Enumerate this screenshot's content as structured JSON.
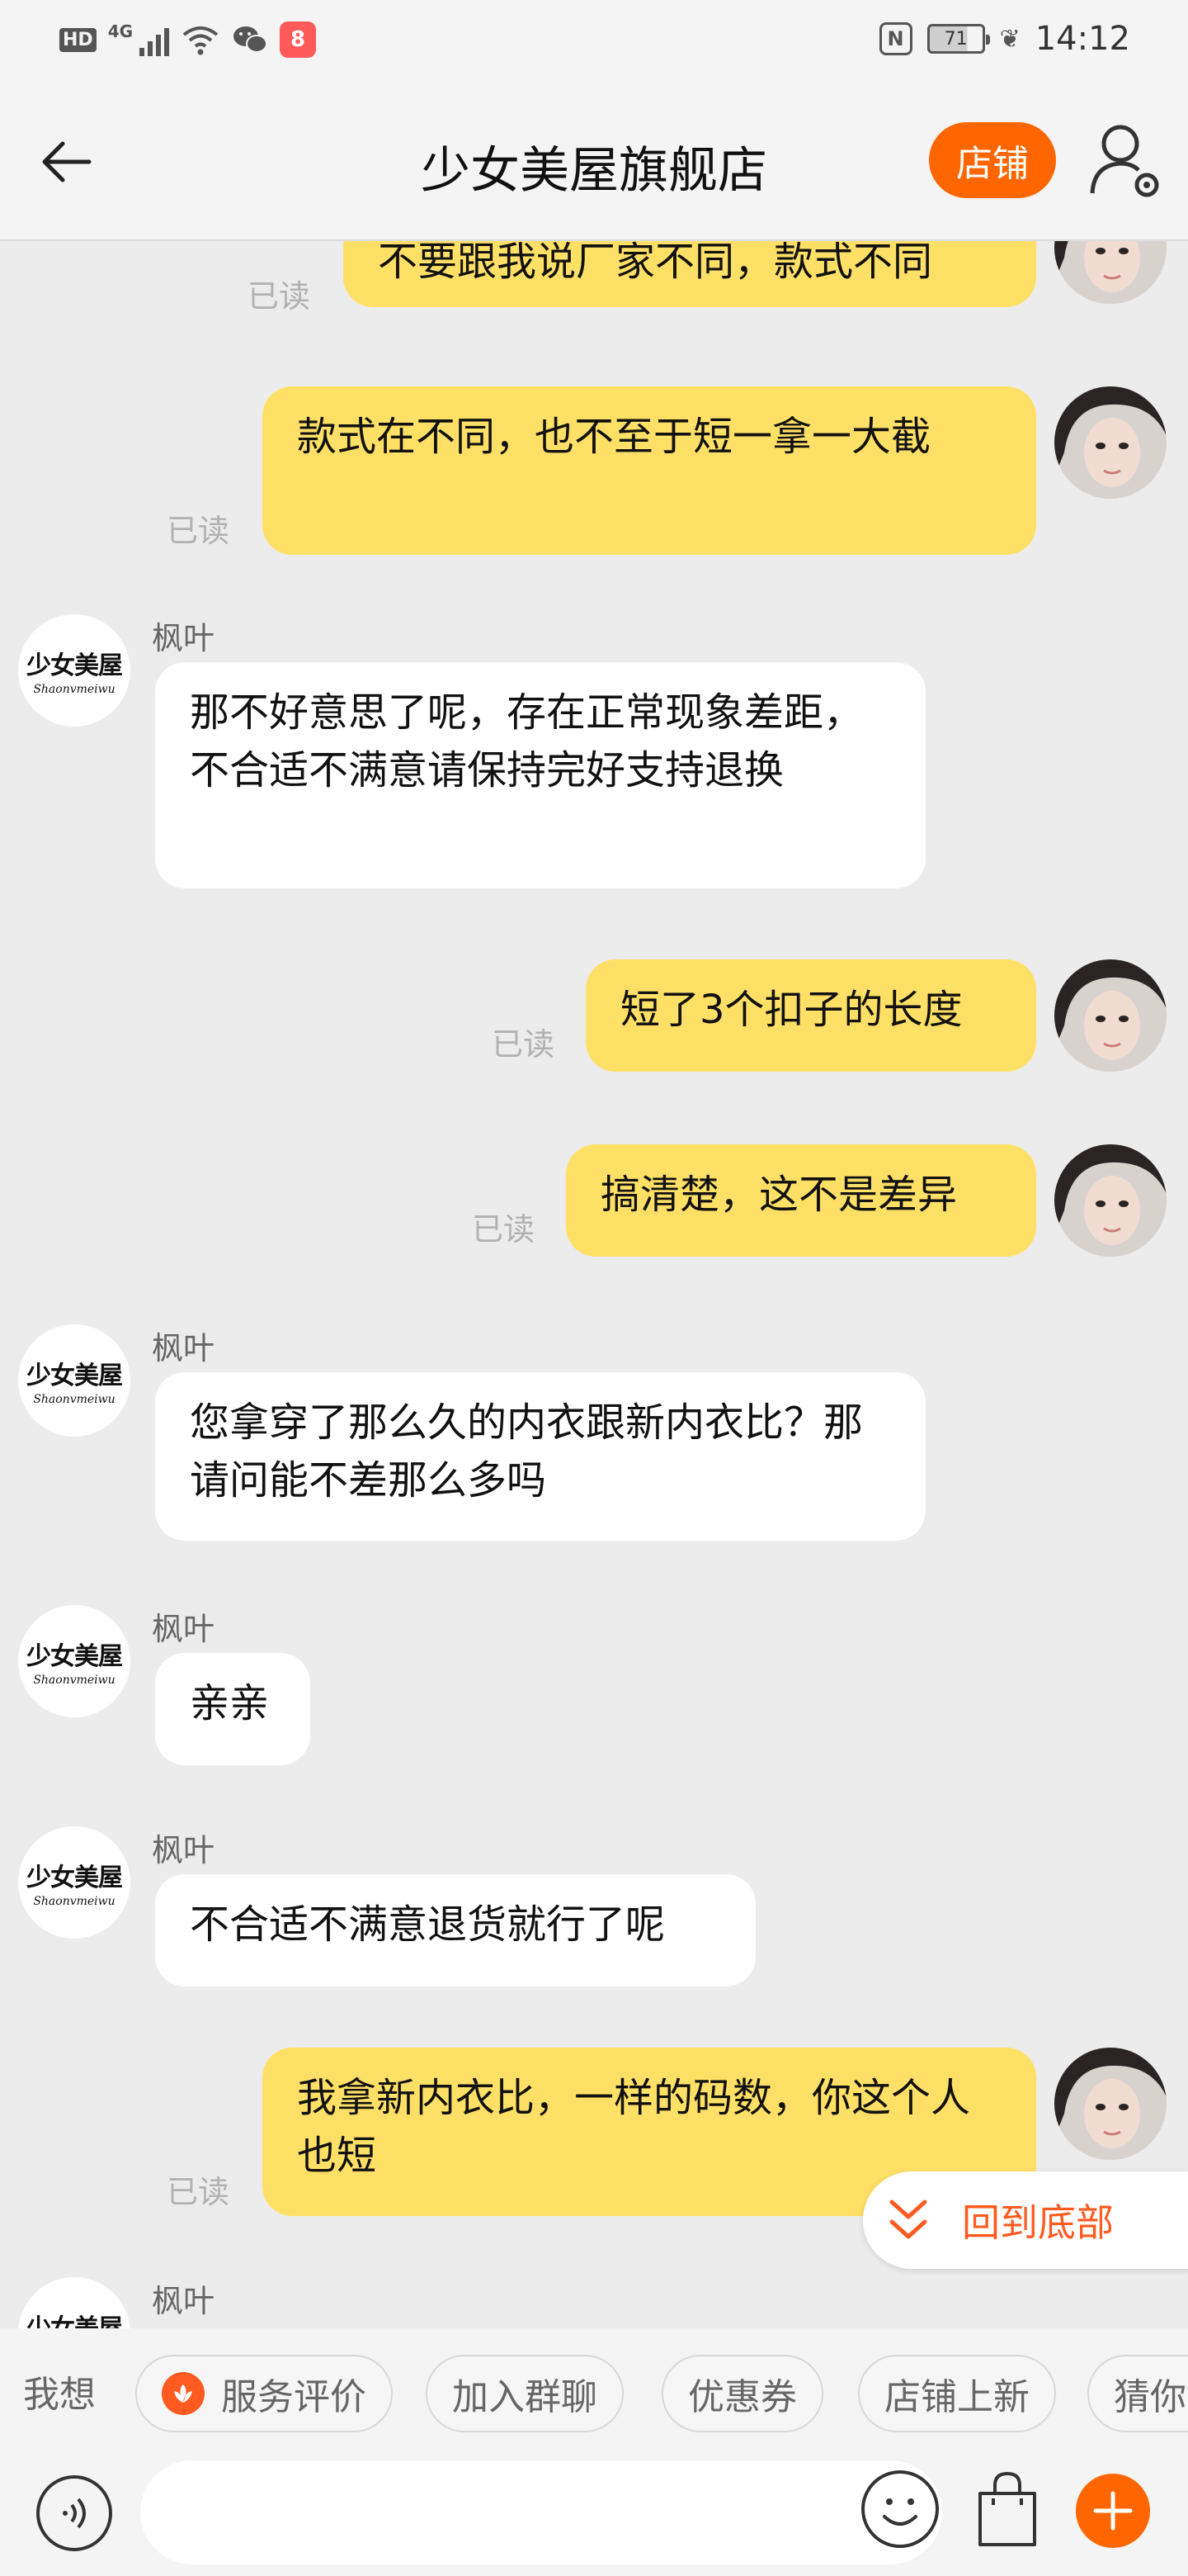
{
  "status_bar": {
    "hd": "HD",
    "network": "4G",
    "app_badge_text": "8",
    "nfc": "N",
    "battery": "71",
    "time": "14:12"
  },
  "header": {
    "title": "少女美屋旗舰店",
    "shop_button": "店铺"
  },
  "shop_avatar": {
    "logo_text": "少女美屋",
    "logo_script": "Shaonvmeiwu"
  },
  "messages": [
    {
      "from": "user",
      "text": "不要跟我说厂家不同，款式不同",
      "status": "已读"
    },
    {
      "from": "user",
      "text": "款式在不同，也不至于短一拿一大截",
      "status": "已读"
    },
    {
      "from": "shop",
      "sender": "枫叶",
      "text": "那不好意思了呢，存在正常现象差距，不合适不满意请保持完好支持退换"
    },
    {
      "from": "user",
      "text": "短了3个扣子的长度",
      "status": "已读"
    },
    {
      "from": "user",
      "text": "搞清楚，这不是差异",
      "status": "已读"
    },
    {
      "from": "shop",
      "sender": "枫叶",
      "text": "您拿穿了那么久的内衣跟新内衣比？那请问能不差那么多吗"
    },
    {
      "from": "shop",
      "sender": "枫叶",
      "text": "亲亲"
    },
    {
      "from": "shop",
      "sender": "枫叶",
      "text": "不合适不满意退货就行了呢"
    },
    {
      "from": "user",
      "text": "我拿新内衣比，一样的码数，你这个人也短",
      "status": "已读"
    },
    {
      "from": "shop",
      "sender": "枫叶",
      "text": ""
    }
  ],
  "scroll_to_bottom": "回到底部",
  "quick_bar": {
    "label": "我想",
    "chips": [
      "服务评价",
      "加入群聊",
      "优惠券",
      "店铺上新",
      "猜你"
    ]
  },
  "input": {
    "placeholder": ""
  },
  "colors": {
    "accent": "#ff6600",
    "user_bubble": "#ffe066",
    "shop_bubble": "#ffffff",
    "background": "#ececec"
  },
  "icons": [
    "back-arrow-icon",
    "user-settings-icon",
    "double-chevron-down-icon",
    "service-rating-icon",
    "voice-icon",
    "emoji-icon",
    "shopping-bag-icon",
    "plus-icon"
  ]
}
